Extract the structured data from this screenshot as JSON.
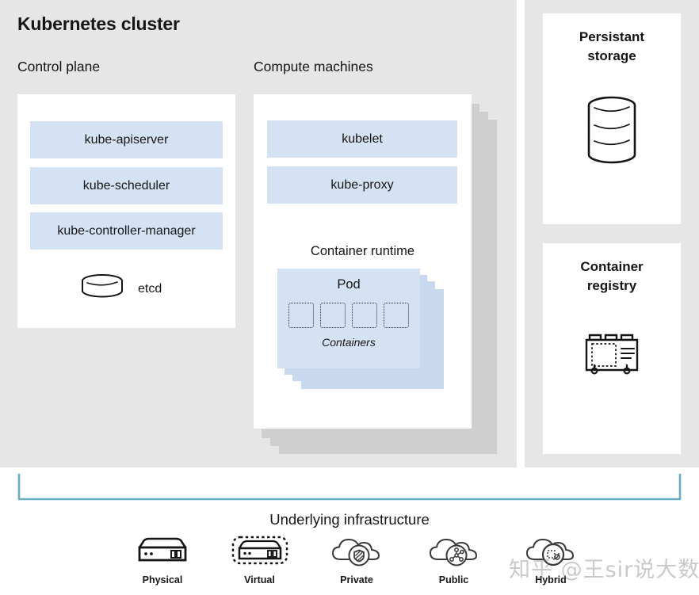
{
  "diagram": {
    "title": "Kubernetes cluster",
    "background_color": "#e6e6e6",
    "component_color": "#d4e2f4",
    "bracket_color": "#68aec2"
  },
  "control_plane": {
    "heading": "Control plane",
    "components": [
      {
        "label": "kube-apiserver"
      },
      {
        "label": "kube-scheduler"
      },
      {
        "label": "kube-controller-manager"
      }
    ],
    "datastore": {
      "label": "etcd",
      "icon": "database-cylinder-icon"
    }
  },
  "compute_machines": {
    "heading": "Compute machines",
    "components": [
      {
        "label": "kubelet"
      },
      {
        "label": "kube-proxy"
      }
    ],
    "container_runtime": {
      "label": "Container runtime",
      "pod": {
        "label": "Pod",
        "containers_label": "Containers",
        "container_count": 4,
        "stack_depth": 4
      }
    },
    "stack_depth": 4
  },
  "side_panels": [
    {
      "title_line_1": "Persistant",
      "title_line_2": "storage",
      "icon": "stacked-disks-icon"
    },
    {
      "title_line_1": "Container",
      "title_line_2": "registry",
      "icon": "registry-case-icon"
    }
  ],
  "infrastructure": {
    "heading": "Underlying infrastructure",
    "items": [
      {
        "label": "Physical",
        "icon": "server-icon"
      },
      {
        "label": "Virtual",
        "icon": "server-dashed-icon"
      },
      {
        "label": "Private",
        "icon": "cloud-shield-icon"
      },
      {
        "label": "Public",
        "icon": "cloud-network-icon"
      },
      {
        "label": "Hybrid",
        "icon": "cloud-hybrid-icon"
      }
    ]
  },
  "watermark": {
    "text": "知乎 @王sir说大数据"
  }
}
